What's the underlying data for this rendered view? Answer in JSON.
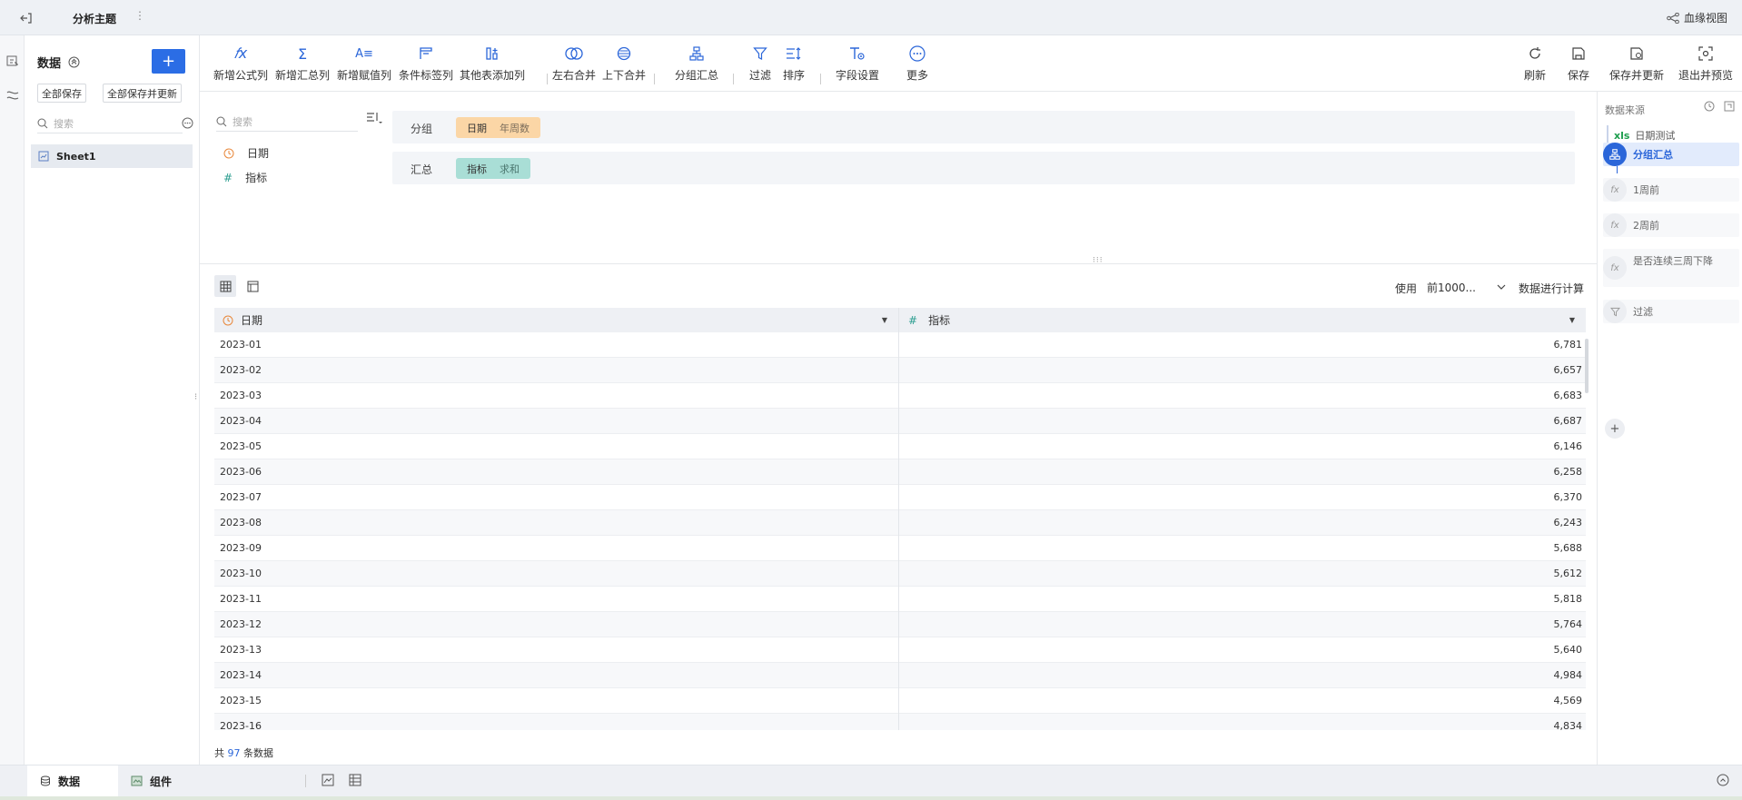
{
  "topbar": {
    "title": "分析主题",
    "more": "⋮",
    "lineage_label": "血缘视图"
  },
  "datapanel": {
    "title": "数据",
    "add": "+",
    "save_all": "全部保存",
    "save_all_update": "全部保存并更新",
    "search_placeholder": "搜索",
    "more": "···",
    "sheets": [
      "Sheet1"
    ]
  },
  "toolbar": {
    "items": [
      {
        "label": "新增公式列",
        "glyph": "𝑓x"
      },
      {
        "label": "新增汇总列",
        "glyph": "Σ"
      },
      {
        "label": "新增赋值列",
        "glyph": "A≡"
      },
      {
        "label": "条件标签列",
        "glyph": ""
      },
      {
        "label": "其他表添加列",
        "glyph": ""
      },
      {
        "label": "左右合并",
        "glyph": ""
      },
      {
        "label": "上下合并",
        "glyph": ""
      },
      {
        "label": "分组汇总",
        "glyph": ""
      },
      {
        "label": "过滤",
        "glyph": ""
      },
      {
        "label": "排序",
        "glyph": ""
      },
      {
        "label": "字段设置",
        "glyph": ""
      },
      {
        "label": "更多",
        "glyph": "···"
      }
    ],
    "right_items": [
      {
        "label": "刷新"
      },
      {
        "label": "保存"
      },
      {
        "label": "保存并更新"
      },
      {
        "label": "退出并预览"
      }
    ]
  },
  "fields": {
    "search_placeholder": "搜索",
    "list": [
      {
        "name": "日期",
        "type": "date"
      },
      {
        "name": "指标",
        "type": "number"
      }
    ],
    "group": {
      "label": "分组",
      "chip_name": "日期",
      "chip_sub": "年周数"
    },
    "summary": {
      "label": "汇总",
      "chip_name": "指标",
      "chip_sub": "求和"
    }
  },
  "grid": {
    "use_label": "使用",
    "row_limit": "前1000...",
    "calc_label": "数据进行计算",
    "columns": [
      "日期",
      "指标"
    ],
    "rows": [
      [
        "2023-01",
        "6,781"
      ],
      [
        "2023-02",
        "6,657"
      ],
      [
        "2023-03",
        "6,683"
      ],
      [
        "2023-04",
        "6,687"
      ],
      [
        "2023-05",
        "6,146"
      ],
      [
        "2023-06",
        "6,258"
      ],
      [
        "2023-07",
        "6,370"
      ],
      [
        "2023-08",
        "6,243"
      ],
      [
        "2023-09",
        "5,688"
      ],
      [
        "2023-10",
        "5,612"
      ],
      [
        "2023-11",
        "5,818"
      ],
      [
        "2023-12",
        "5,764"
      ],
      [
        "2023-13",
        "5,640"
      ],
      [
        "2023-14",
        "4,984"
      ],
      [
        "2023-15",
        "4,569"
      ],
      [
        "2023-16",
        "4,834"
      ]
    ],
    "count_prefix": "共",
    "count": "97",
    "count_suffix": "条数据"
  },
  "rightpanel": {
    "title": "数据来源",
    "source_badge": "xls",
    "source": "日期测试",
    "steps": [
      {
        "label": "分组汇总",
        "active": true,
        "glyph": ""
      },
      {
        "label": "1周前",
        "active": false,
        "glyph": "fx"
      },
      {
        "label": "2周前",
        "active": false,
        "glyph": "fx"
      },
      {
        "label": "是否连续三周下降",
        "active": false,
        "glyph": "fx"
      },
      {
        "label": "过滤",
        "active": false,
        "glyph": ""
      }
    ],
    "add": "+"
  },
  "bottombar": {
    "tab_data": "数据",
    "tab_component": "组件"
  },
  "colors": {
    "accent": "#2b66d9",
    "chip_orange": "#fbd6a6",
    "chip_teal": "#a9ded6"
  }
}
